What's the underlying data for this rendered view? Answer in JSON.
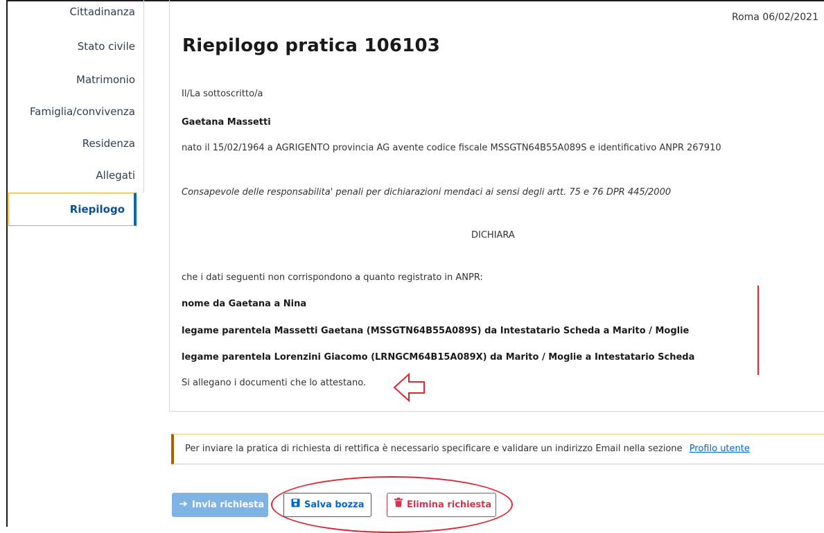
{
  "sidebar": {
    "items": [
      {
        "label": "Cittadinanza"
      },
      {
        "label": "Stato civile"
      },
      {
        "label": "Matrimonio"
      },
      {
        "label": "Famiglia/convivenza"
      },
      {
        "label": "Residenza"
      },
      {
        "label": "Allegati"
      },
      {
        "label": "Riepilogo"
      }
    ],
    "active_index": 6
  },
  "header": {
    "date": "Roma 06/02/2021",
    "title": "Riepilogo pratica 106103"
  },
  "declaration": {
    "intro": "Il/La sottoscritto/a",
    "name": "Gaetana Massetti",
    "details": "nato il 15/02/1964 a AGRIGENTO provincia AG avente codice fiscale MSSGTN64B55A089S e identificativo ANPR 267910",
    "awareness": "Consapevole delle responsabilita' penali per dichiarazioni mendaci ai sensi degli artt. 75 e 76 DPR 445/2000",
    "heading": "DICHIARA",
    "statement": "che i dati seguenti non corrispondono a quanto registrato in ANPR:",
    "changes": [
      "nome da Gaetana a Nina",
      "legame parentela Massetti Gaetana (MSSGTN64B55A089S) da Intestatario Scheda a Marito / Moglie",
      "legame parentela Lorenzini Giacomo (LRNGCM64B15A089X) da Marito / Moglie a Intestatario Scheda"
    ],
    "attachments_note": "Si allegano i documenti che lo attestano."
  },
  "alert": {
    "text": "Per inviare la pratica di richiesta di rettifica è necessario specificare e validare un indirizzo Email nella sezione",
    "link": "Profilo utente"
  },
  "actions": {
    "send": "Invia richiesta",
    "save": "Salva bozza",
    "delete": "Elimina richiesta"
  },
  "icons": {
    "send": "arrow-right-icon",
    "save": "floppy-disk-icon",
    "delete": "trash-icon"
  },
  "colors": {
    "primary": "#0066cc",
    "danger": "#d1344c",
    "warning": "#a66300",
    "annotation": "#e0252e",
    "active_border": "#e8a817"
  }
}
